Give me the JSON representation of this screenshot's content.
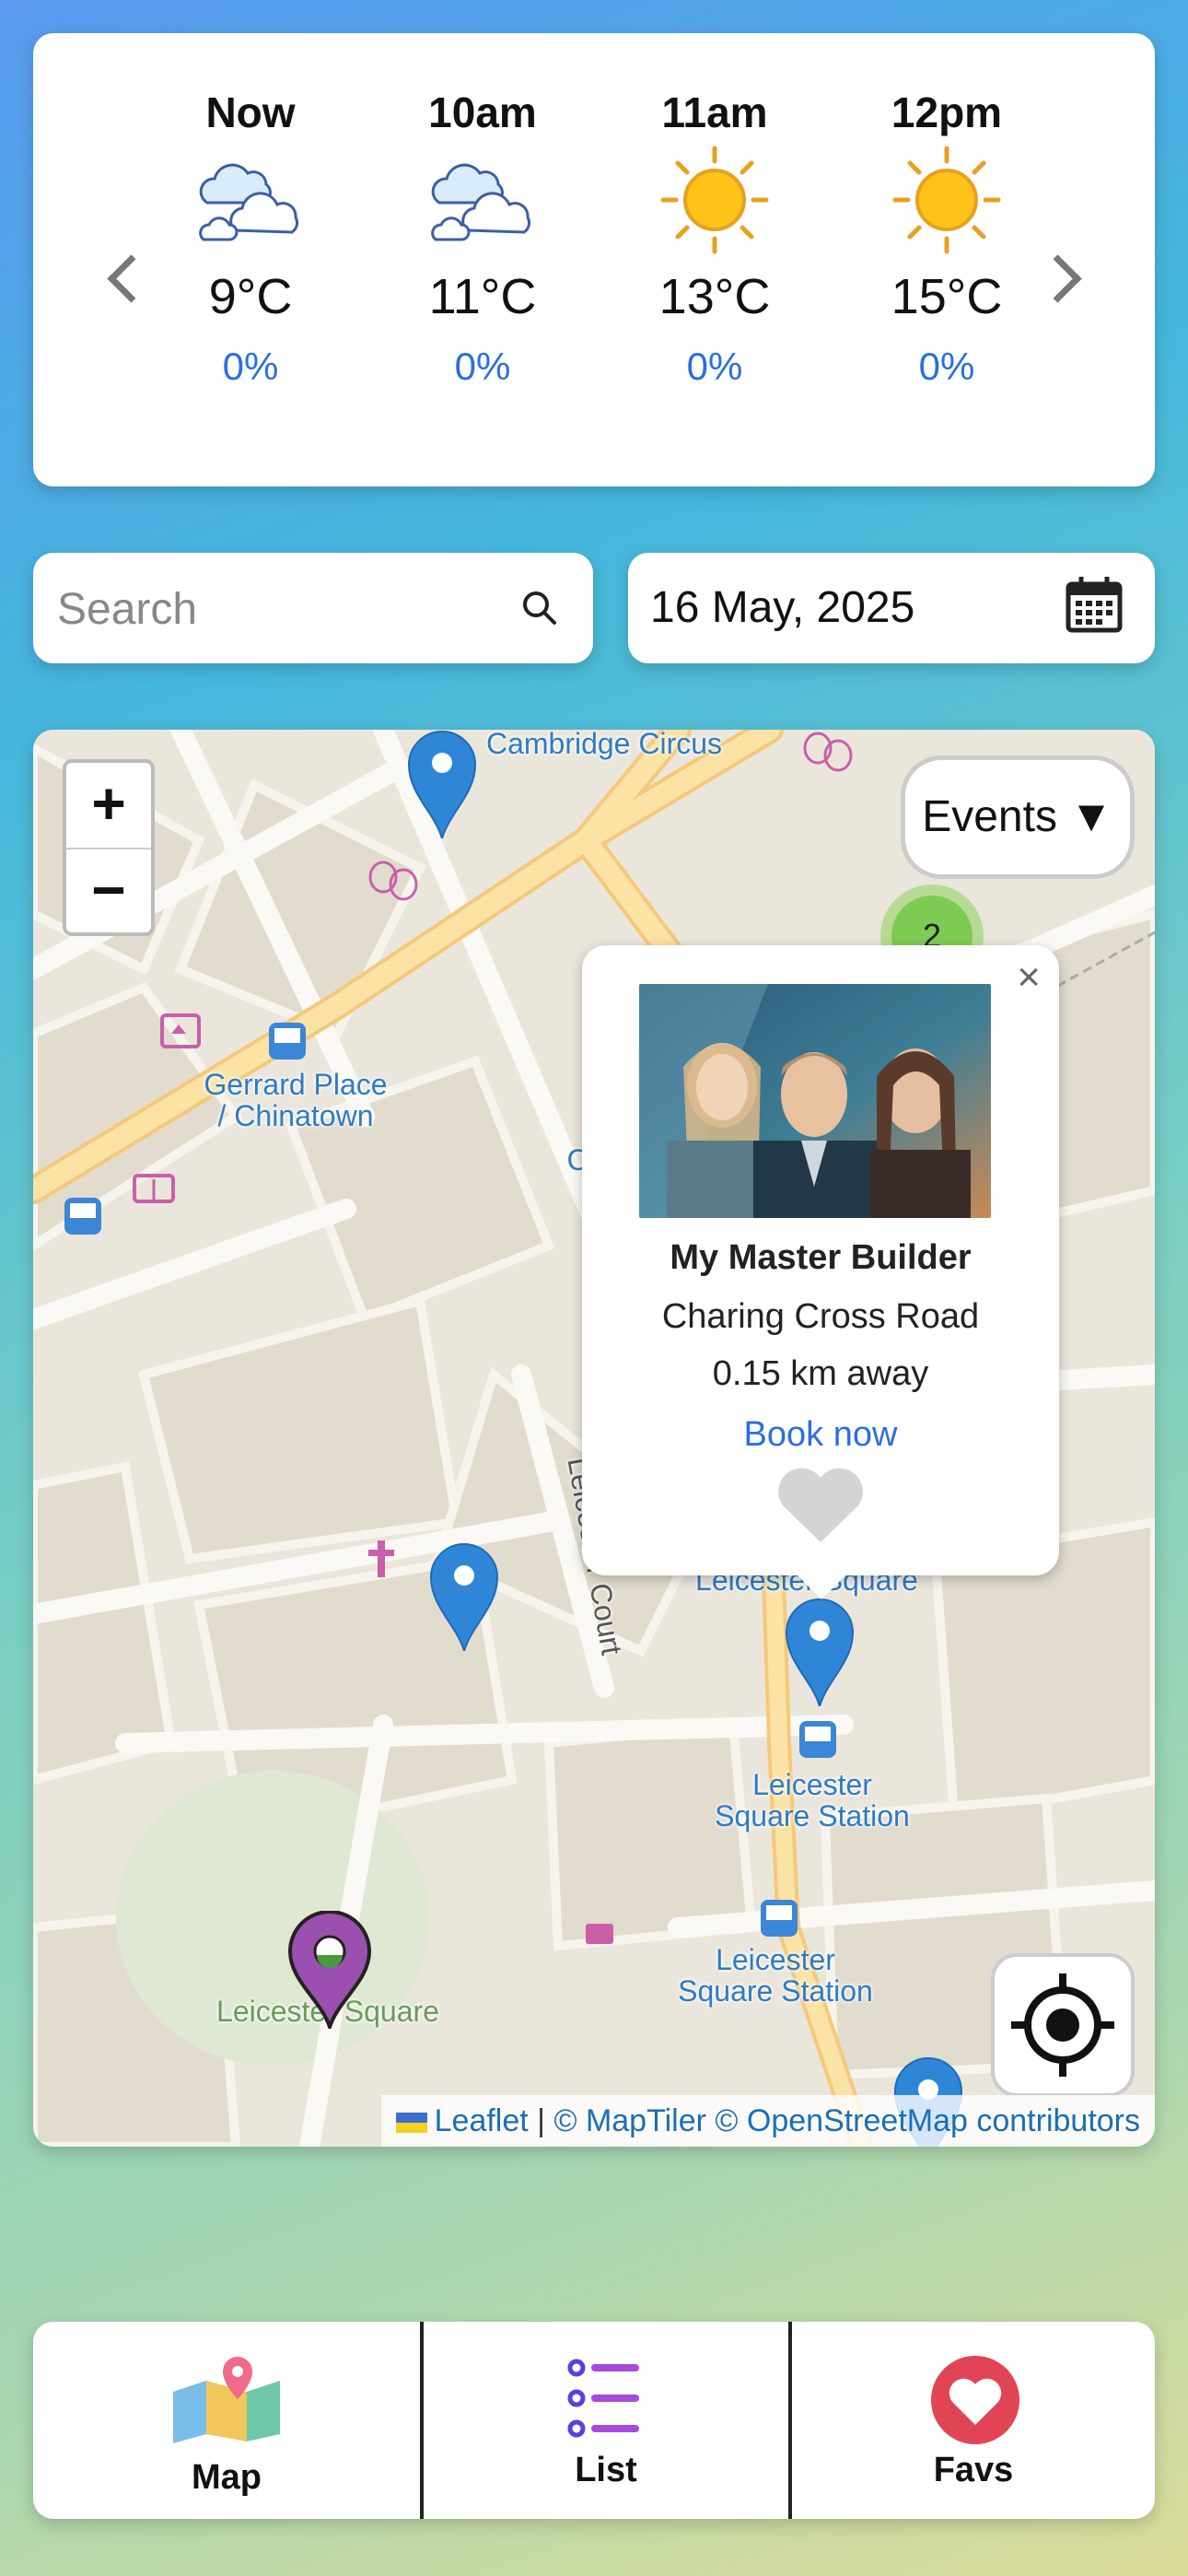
{
  "weather": {
    "hours": [
      {
        "time": "Now",
        "icon": "partly-cloudy-icon",
        "temp": "9°C",
        "rain": "0%"
      },
      {
        "time": "10am",
        "icon": "partly-cloudy-icon",
        "temp": "11°C",
        "rain": "0%"
      },
      {
        "time": "11am",
        "icon": "sun-icon",
        "temp": "13°C",
        "rain": "0%"
      },
      {
        "time": "12pm",
        "icon": "sun-icon",
        "temp": "15°C",
        "rain": "0%"
      }
    ]
  },
  "search": {
    "placeholder": "Search",
    "value": ""
  },
  "date": {
    "value": "16 May, 2025"
  },
  "map": {
    "zoom_in": "+",
    "zoom_out": "−",
    "filter_label": "Events ▼",
    "cluster_count": "2",
    "labels": {
      "cambridge": "Cambridge Circus",
      "gerrard": "Gerrard Place\n/ Chinatown",
      "leicester_court": "Leicester Court",
      "leicester_sq_top": "Leicester Square",
      "station1": "Leicester\nSquare Station",
      "station2": "Leicester\nSquare Station",
      "leicester_park": "Leicester Square",
      "partial_c": "C"
    },
    "attribution": {
      "leaflet": "Leaflet",
      "sep": " | ",
      "maptiler": "© MapTiler",
      "osm": "© OpenStreetMap contributors"
    }
  },
  "popup": {
    "title": "My Master Builder",
    "venue": "Charing Cross Road",
    "distance": "0.15 km away",
    "book": "Book now",
    "close": "×"
  },
  "nav": {
    "map": "Map",
    "list": "List",
    "favs": "Favs"
  },
  "colors": {
    "accent_blue": "#2a6fe0",
    "pin_blue": "#2f86d6",
    "pin_purple": "#9b4fae",
    "fav_red": "#e04455",
    "list_purple": "#7b3fe4"
  }
}
